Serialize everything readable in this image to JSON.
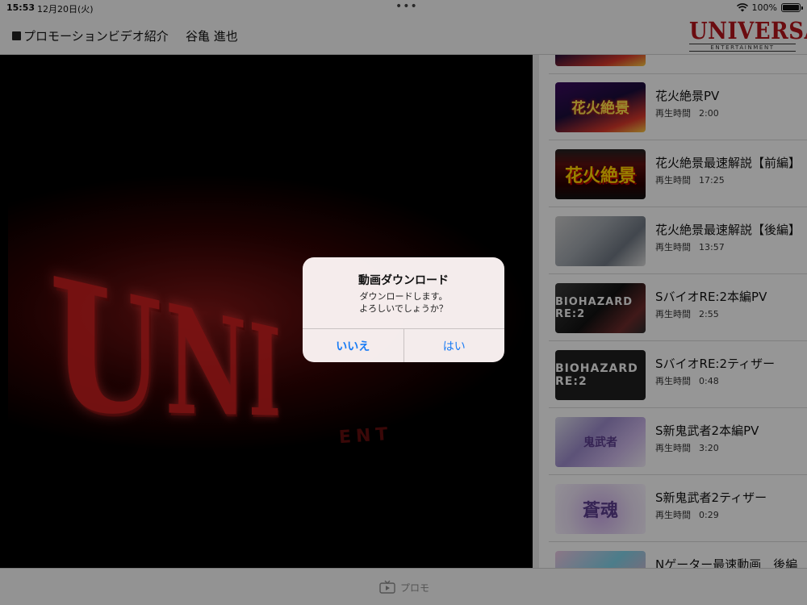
{
  "status": {
    "time": "15:53",
    "date": "12月20日(火)",
    "dots": "•••",
    "battery": "100%",
    "battery_level": 1.0
  },
  "nav": {
    "title": "プロモーションビデオ紹介",
    "user": "谷亀 進也",
    "brand": {
      "name": "UNIVERSAL",
      "sub": "ENTERTAINMENT"
    }
  },
  "video": {
    "logo_text": "UNI",
    "logo_sub": "ENT"
  },
  "list": {
    "duration_label": "再生時間",
    "items": [
      {
        "title": "",
        "duration": "",
        "thumb_text": ""
      },
      {
        "title": "花火絶景PV",
        "duration": "2:00",
        "thumb_text": "花火絶景"
      },
      {
        "title": "花火絶景最速解説【前編】",
        "duration": "17:25",
        "thumb_text": "花火絶景"
      },
      {
        "title": "花火絶景最速解説【後編】",
        "duration": "13:57",
        "thumb_text": ""
      },
      {
        "title": "SバイオRE:2本編PV",
        "duration": "2:55",
        "thumb_text": "BIOHAZARD RE:2"
      },
      {
        "title": "SバイオRE:2ティザー",
        "duration": "0:48",
        "thumb_text": "BIOHAZARD RE:2"
      },
      {
        "title": "S新鬼武者2本編PV",
        "duration": "3:20",
        "thumb_text": "鬼武者"
      },
      {
        "title": "S新鬼武者2ティザー",
        "duration": "0:29",
        "thumb_text": "蒼魂"
      },
      {
        "title": "Nゲーター最速動画　後編",
        "duration": "",
        "thumb_text": ""
      }
    ]
  },
  "tab": {
    "label": "プロモ"
  },
  "alert": {
    "title": "動画ダウンロード",
    "message_line1": "ダウンロードします。",
    "message_line2": "よろしいでしょうか？",
    "no_label": "いいえ",
    "yes_label": "はい"
  },
  "colors": {
    "accent": "#1a7cf5",
    "brand": "#b3141b"
  }
}
